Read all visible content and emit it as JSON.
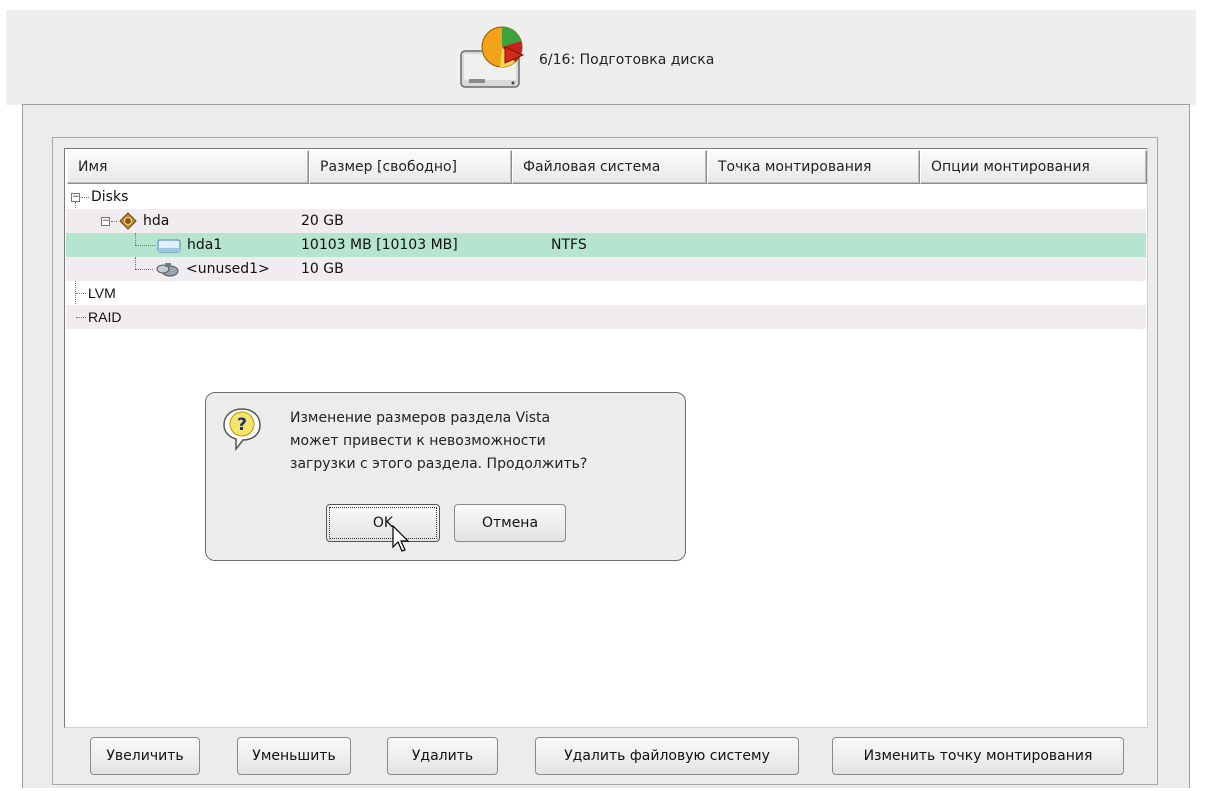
{
  "header": {
    "title": "6/16: Подготовка диска",
    "icon": "disk-pie-icon"
  },
  "columns": [
    "Имя",
    "Размер [свободно]",
    "Файловая система",
    "Точка монтирования",
    "Опции монтирования"
  ],
  "tree": {
    "disks": {
      "name": "Disks"
    },
    "hda": {
      "name": "hda",
      "size": "20 GB"
    },
    "hda1": {
      "name": "hda1",
      "size": "10103 MB [10103 MB]",
      "fs": "NTFS"
    },
    "unused1": {
      "name": "<unused1>",
      "size": "10 GB"
    },
    "lvm": {
      "name": "LVM"
    },
    "raid": {
      "name": "RAID"
    }
  },
  "dialog": {
    "lines": [
      "Изменение размеров раздела Vista",
      "может привести к невозможности",
      "загрузки с этого раздела. Продолжить?"
    ],
    "ok_label": "OK",
    "cancel_label": "Отмена",
    "icon": "question-icon"
  },
  "buttons": {
    "grow": "Увеличить",
    "shrink": "Уменьшить",
    "delete": "Удалить",
    "delete_fs": "Удалить файловую систему",
    "change_mount": "Изменить точку монтирования"
  },
  "colors": {
    "selected_row": "#b5e4cf",
    "alt_row": "#f1ecef",
    "window_bg": "#ececed"
  }
}
